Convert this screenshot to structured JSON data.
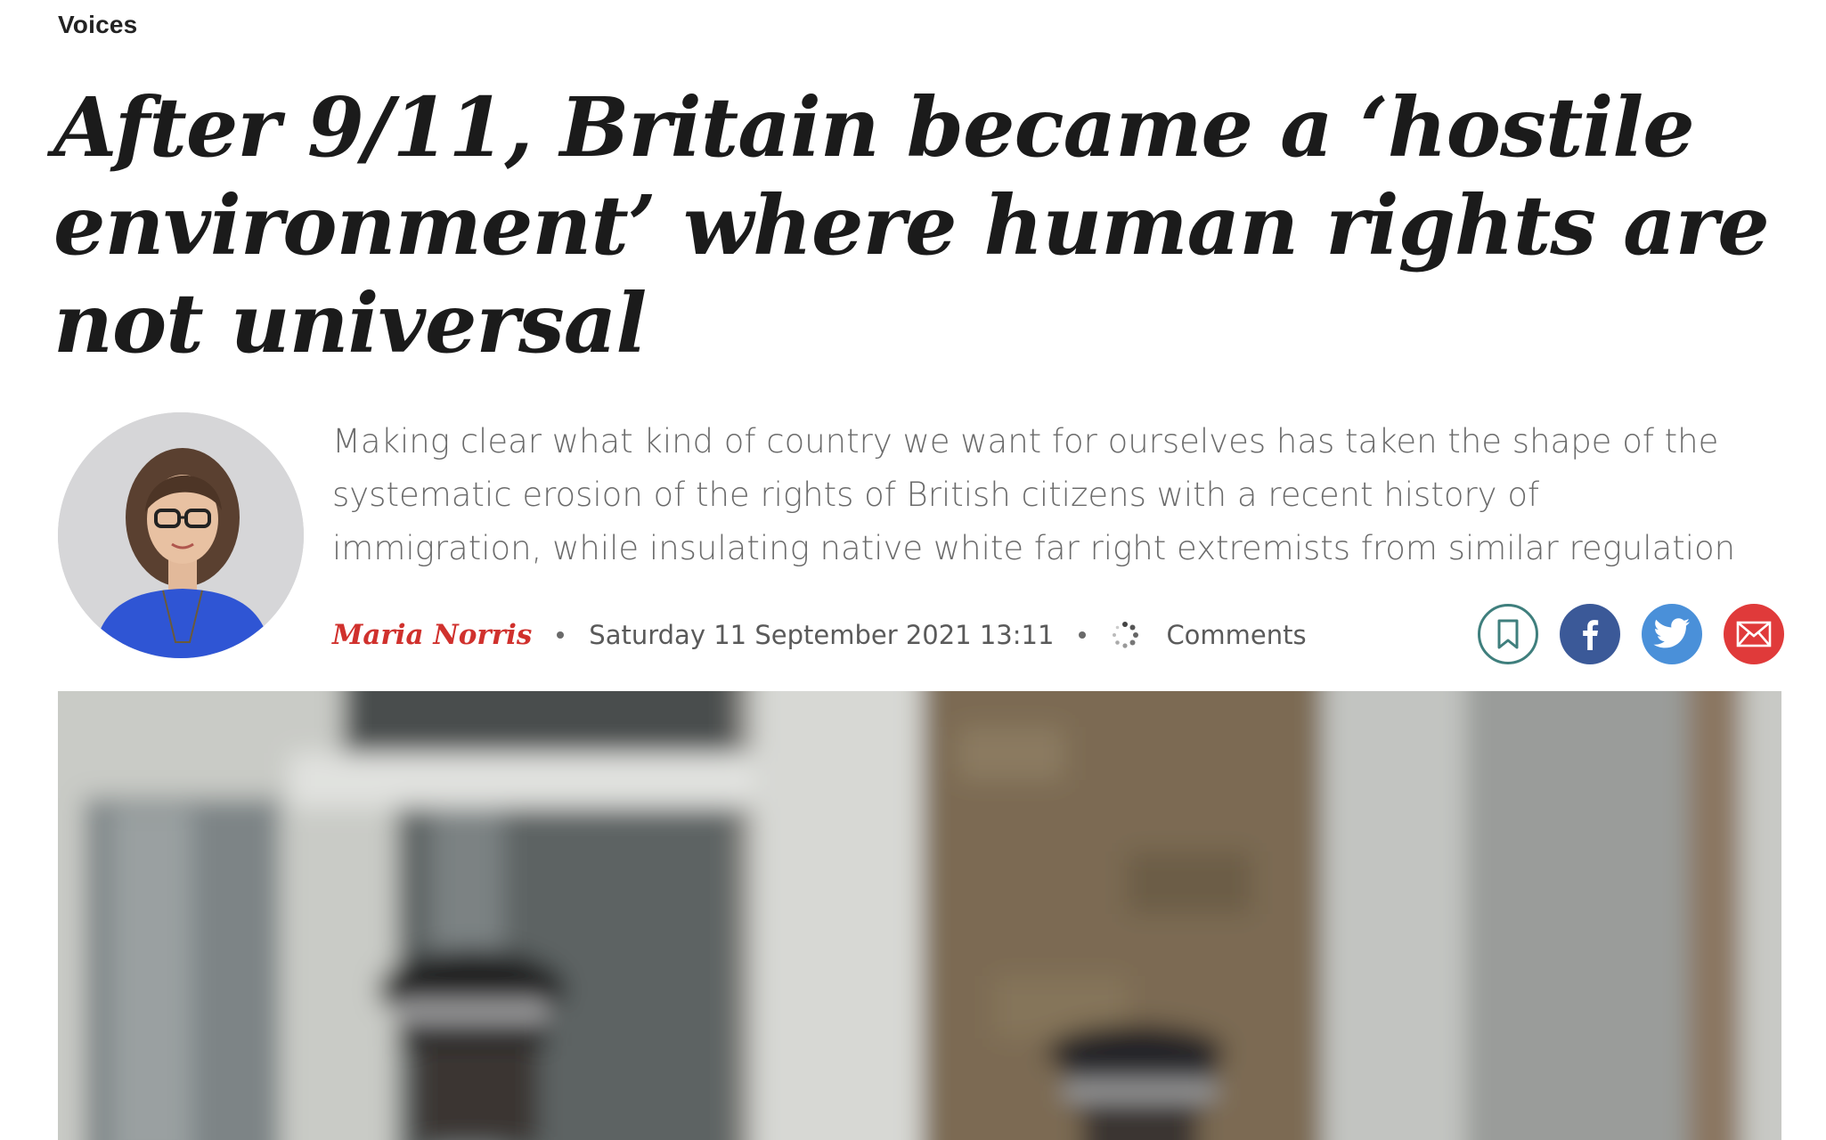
{
  "section": {
    "label": "Voices"
  },
  "article": {
    "headline": "After 9/11, Britain became a ‘hostile environment’ where human rights are not universal",
    "standfirst": "Making clear what kind of country we want for ourselves has taken the shape of the systematic erosion of the rights of British citizens with a recent history of immigration, while insulating native white far right extremists from similar regulation",
    "author": "Maria Norris",
    "date": "Saturday 11 September 2021 13:11",
    "comments_label": "Comments"
  },
  "share_buttons": [
    {
      "name": "bookmark",
      "icon": "bookmark-icon",
      "color": "#3f7f7d"
    },
    {
      "name": "facebook",
      "icon": "facebook-icon",
      "color": "#3b5998"
    },
    {
      "name": "twitter",
      "icon": "twitter-icon",
      "color": "#4a90d9"
    },
    {
      "name": "email",
      "icon": "envelope-icon",
      "color": "#e03a3a"
    }
  ],
  "colors": {
    "author": "#d0312d",
    "headline": "#1b1b1b",
    "standfirst": "#6b6b6b"
  }
}
